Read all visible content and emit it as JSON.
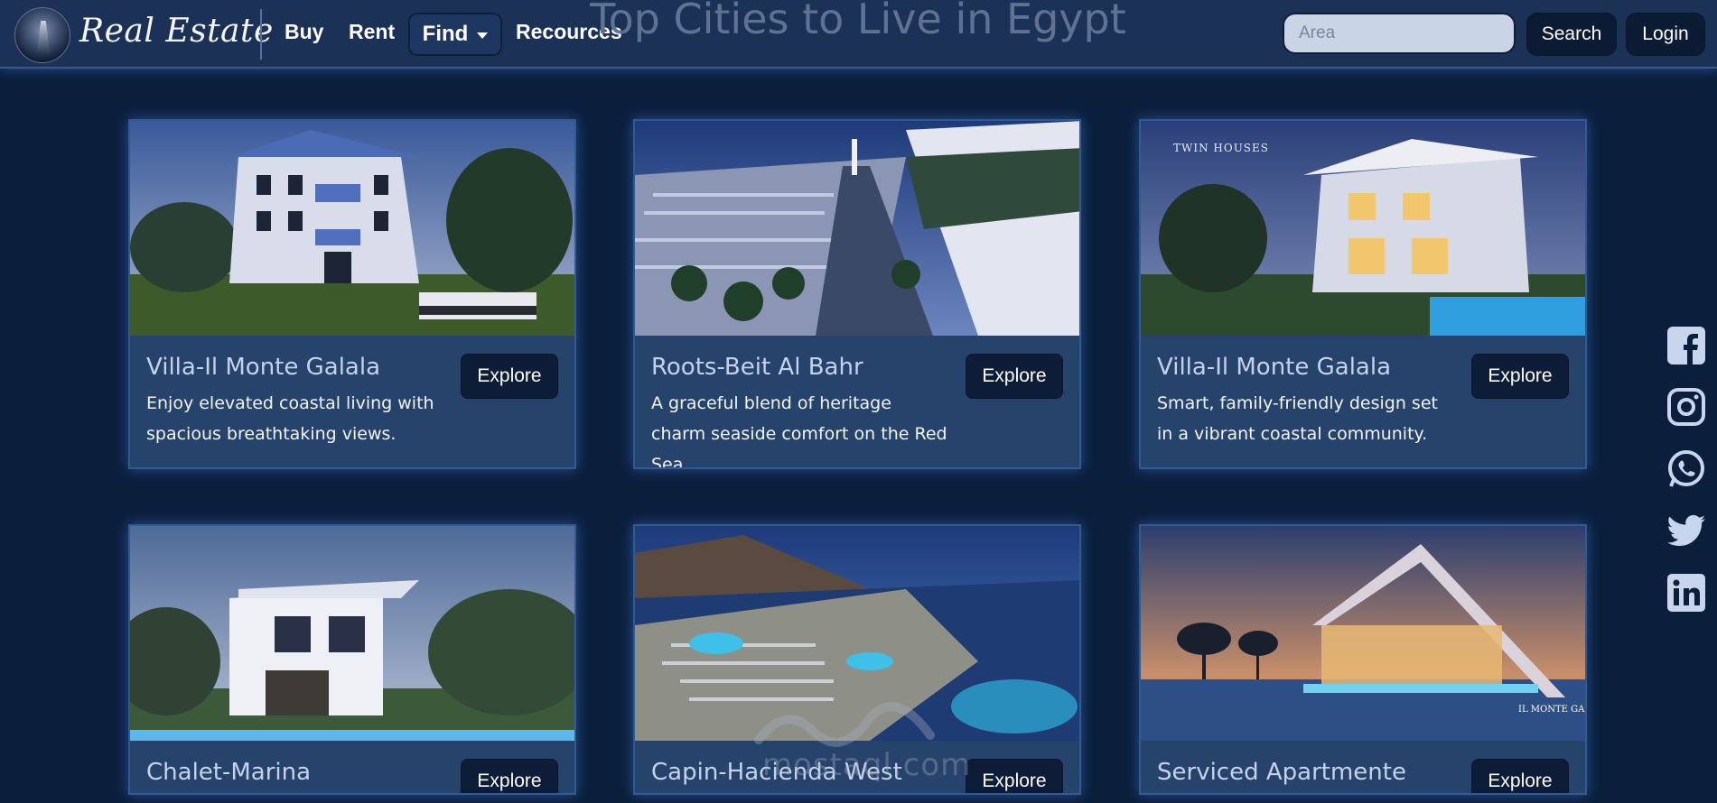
{
  "nav": {
    "brand": "Real Estate",
    "links": [
      "Buy",
      "Rent"
    ],
    "find_label": "Find",
    "resources_label": "Recources",
    "page_heading": "Top Cities to Live in Egypt",
    "search_placeholder": "Area",
    "search_button": "Search",
    "login_button": "Login"
  },
  "cards": [
    {
      "title": "Villa-Il Monte Galala",
      "desc": "Enjoy elevated coastal living with spacious breathtaking views.",
      "button": "Explore"
    },
    {
      "title": "Roots-Beit Al Bahr",
      "desc": "A graceful blend of heritage charm seaside comfort on the Red Sea.",
      "button": "Explore"
    },
    {
      "title": "Villa-Il Monte Galala",
      "desc": "Smart, family-friendly design set in a vibrant coastal community.",
      "button": "Explore",
      "image_text": "TWIN HOUSES"
    },
    {
      "title": "Chalet-Marina",
      "desc": "",
      "button": "Explore"
    },
    {
      "title": "Capin-Hacienda West",
      "desc": "",
      "button": "Explore"
    },
    {
      "title": "Serviced Apartmente",
      "desc": "",
      "button": "Explore",
      "image_text": "IL MONTE GALALA"
    }
  ],
  "social": [
    "facebook-icon",
    "instagram-icon",
    "whatsapp-icon",
    "twitter-icon",
    "linkedin-icon"
  ],
  "watermark": "mostaql.com",
  "colors": {
    "background": "#0b1f3d",
    "navbar": "#1b3256",
    "card": "#26436c",
    "button": "#0e1d37",
    "icon": "#c7d6ec"
  }
}
